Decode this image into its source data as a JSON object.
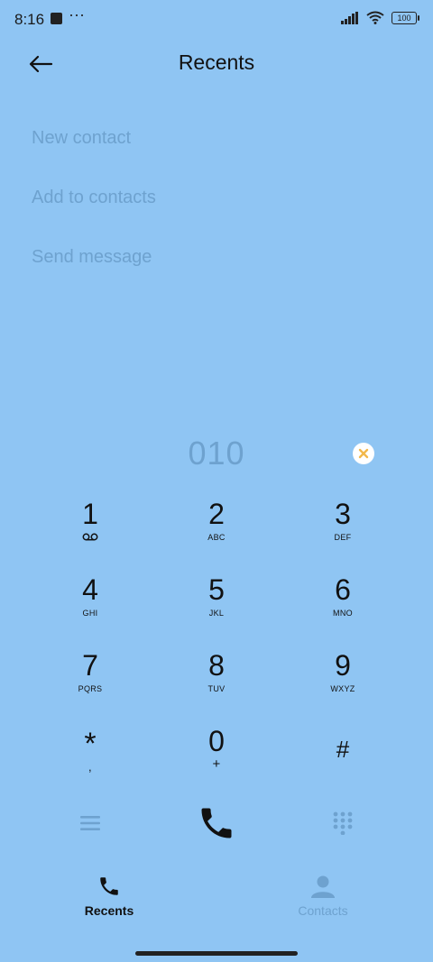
{
  "status_bar": {
    "time": "8:16",
    "more": "···",
    "battery": "100"
  },
  "header": {
    "title": "Recents",
    "back_icon": "arrow-left-icon"
  },
  "actions": {
    "new_contact": "New contact",
    "add_to_contacts": "Add to contacts",
    "send_message": "Send message"
  },
  "dialer": {
    "number": "010",
    "keys": [
      {
        "digit": "1",
        "letters": ""
      },
      {
        "digit": "2",
        "letters": "ABC"
      },
      {
        "digit": "3",
        "letters": "DEF"
      },
      {
        "digit": "4",
        "letters": "GHI"
      },
      {
        "digit": "5",
        "letters": "JKL"
      },
      {
        "digit": "6",
        "letters": "MNO"
      },
      {
        "digit": "7",
        "letters": "PQRS"
      },
      {
        "digit": "8",
        "letters": "TUV"
      },
      {
        "digit": "9",
        "letters": "WXYZ"
      },
      {
        "digit": "*",
        "letters": ","
      },
      {
        "digit": "0",
        "letters": "+"
      },
      {
        "digit": "#",
        "letters": ""
      }
    ]
  },
  "bottom_nav": {
    "recents": "Recents",
    "contacts": "Contacts"
  },
  "colors": {
    "background": "#8fc5f3",
    "muted_text": "#6ea2cf",
    "clear_icon_accent": "#f2b84b"
  }
}
